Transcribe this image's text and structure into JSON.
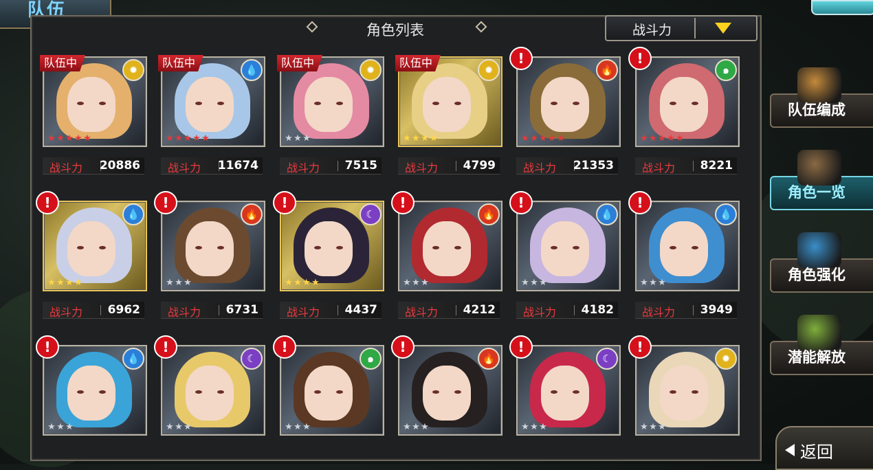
{
  "header": {
    "tab_title": "队伍",
    "panel_title": "角色列表"
  },
  "sort": {
    "selected": "战斗力",
    "icon": "triangle-down-icon"
  },
  "power_label": "战斗力",
  "cards": [
    {
      "tag": "队伍中",
      "alert": "",
      "element": "light",
      "stars": 5,
      "power": "20886",
      "hair": "#e4b06c",
      "frame": "silver"
    },
    {
      "tag": "队伍中",
      "alert": "",
      "element": "water",
      "stars": 5,
      "power": "11674",
      "hair": "#a8c7e8",
      "frame": "silver"
    },
    {
      "tag": "队伍中",
      "alert": "",
      "element": "light",
      "stars": 3,
      "power": "7515",
      "hair": "#e58aa3",
      "frame": "silver"
    },
    {
      "tag": "队伍中",
      "alert": "",
      "element": "light",
      "stars": 4,
      "power": "4799",
      "hair": "#e8cf86",
      "frame": "gold"
    },
    {
      "tag": "",
      "alert": "!",
      "element": "fire",
      "stars": 5,
      "power": "21353",
      "hair": "#8a6c3a",
      "frame": "silver"
    },
    {
      "tag": "",
      "alert": "!",
      "element": "wind",
      "stars": 5,
      "power": "8221",
      "hair": "#cf6a70",
      "frame": "silver"
    },
    {
      "tag": "",
      "alert": "!",
      "element": "water",
      "stars": 4,
      "power": "6962",
      "hair": "#c9cfe6",
      "frame": "gold"
    },
    {
      "tag": "",
      "alert": "!",
      "element": "fire",
      "stars": 3,
      "power": "6731",
      "hair": "#6b4a30",
      "frame": "silver"
    },
    {
      "tag": "",
      "alert": "!",
      "element": "dark",
      "stars": 4,
      "power": "4437",
      "hair": "#2b2438",
      "frame": "gold"
    },
    {
      "tag": "",
      "alert": "!",
      "element": "fire",
      "stars": 3,
      "power": "4212",
      "hair": "#b02a30",
      "frame": "silver"
    },
    {
      "tag": "",
      "alert": "!",
      "element": "water",
      "stars": 3,
      "power": "4182",
      "hair": "#c7b6e0",
      "frame": "silver"
    },
    {
      "tag": "",
      "alert": "!",
      "element": "water",
      "stars": 3,
      "power": "3949",
      "hair": "#3e8ed0",
      "frame": "silver"
    },
    {
      "tag": "",
      "alert": "!",
      "element": "water",
      "stars": 3,
      "power": "",
      "hair": "#3aa4d8",
      "frame": "silver"
    },
    {
      "tag": "",
      "alert": "!",
      "element": "dark",
      "stars": 3,
      "power": "",
      "hair": "#e8c96a",
      "frame": "silver"
    },
    {
      "tag": "",
      "alert": "!",
      "element": "wind",
      "stars": 3,
      "power": "",
      "hair": "#5a3824",
      "frame": "silver"
    },
    {
      "tag": "",
      "alert": "!",
      "element": "fire",
      "stars": 3,
      "power": "",
      "hair": "#262020",
      "frame": "silver"
    },
    {
      "tag": "",
      "alert": "!",
      "element": "dark",
      "stars": 3,
      "power": "",
      "hair": "#c8284a",
      "frame": "silver"
    },
    {
      "tag": "",
      "alert": "!",
      "element": "light",
      "stars": 3,
      "power": "",
      "hair": "#ead7b8",
      "frame": "silver"
    }
  ],
  "side_menu": [
    {
      "label": "队伍编成",
      "active": false,
      "icon": "team-portraits-icon"
    },
    {
      "label": "角色一览",
      "active": true,
      "icon": "book-icon"
    },
    {
      "label": "角色强化",
      "active": false,
      "icon": "enhance-icon"
    },
    {
      "label": "潜能解放",
      "active": false,
      "icon": "potential-orb-icon"
    }
  ],
  "back_button": {
    "label": "返回",
    "icon": "back-arrow-icon"
  },
  "colors": {
    "light": "#e0b21c",
    "water": "#2b7fd8",
    "fire": "#d8371f",
    "wind": "#2fa846",
    "dark": "#7b3fc4",
    "gold_star": "#ffd54a",
    "grey_star": "#cfd3d8",
    "red_star": "#e23b3b",
    "alert": "#d6101a"
  }
}
